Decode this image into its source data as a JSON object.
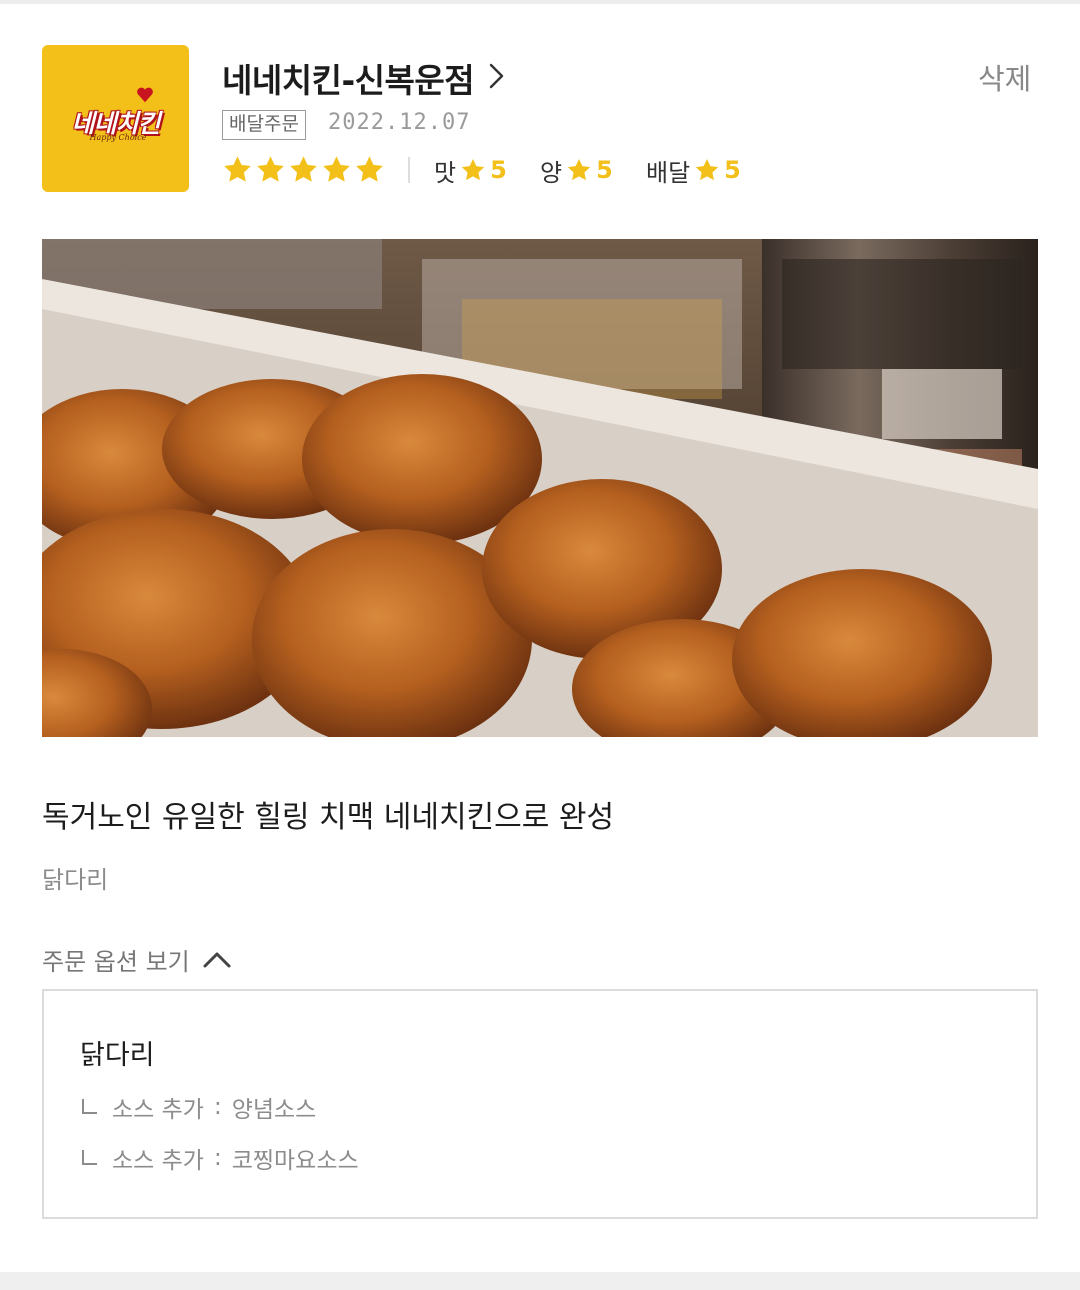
{
  "store": {
    "logo_text": "네네치킨",
    "logo_sub": "Happy Choice",
    "name": "네네치킨-신복운점",
    "delete_label": "삭제"
  },
  "order": {
    "type_badge": "배달주문",
    "date": "2022.12.07"
  },
  "rating": {
    "overall_stars": 5,
    "taste_label": "맛",
    "taste_value": "5",
    "amount_label": "양",
    "amount_value": "5",
    "delivery_label": "배달",
    "delivery_value": "5"
  },
  "review": {
    "text": "독거노인 유일한 힐링 치맥 네네치킨으로 완성",
    "menu": "닭다리"
  },
  "options": {
    "toggle_label": "주문 옵션 보기",
    "item_name": "닭다리",
    "lines": [
      {
        "label": "소스 추가",
        "sep": ":",
        "value": "양념소스"
      },
      {
        "label": "소스 추가",
        "sep": ":",
        "value": "코찡마요소스"
      }
    ]
  },
  "colors": {
    "accent_yellow": "#f3c01a",
    "logo_red": "#b0121b",
    "muted_text": "#8c8c8c",
    "border": "#dcdcdc"
  },
  "icons": {
    "store_chevron": "chevron-right-icon",
    "star": "star-icon",
    "options_toggle": "chevron-up-icon",
    "option_branch": "branch-corner-icon"
  }
}
